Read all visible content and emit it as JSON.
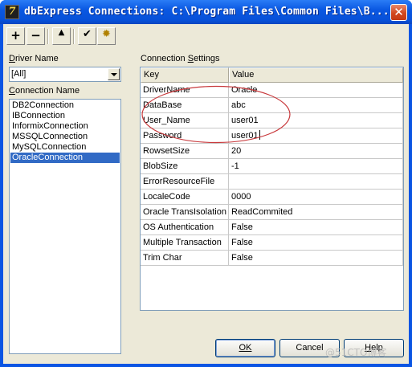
{
  "window": {
    "title": "dbExpress Connections: C:\\Program Files\\Common Files\\B...",
    "close_glyph": "✕",
    "app_icon": "7"
  },
  "toolbar": {
    "add": "+",
    "remove": "−",
    "up": "▲",
    "check": "✔",
    "gear": "✹"
  },
  "driver": {
    "label": "Driver Name",
    "value": "[All]"
  },
  "connections": {
    "label": "Connection Name",
    "items": [
      "DB2Connection",
      "IBConnection",
      "InformixConnection",
      "MSSQLConnection",
      "MySQLConnection",
      "OracleConnection"
    ],
    "selected_index": 5
  },
  "settings": {
    "label": "Connection Settings",
    "headers": {
      "key": "Key",
      "value": "Value"
    },
    "rows": [
      {
        "key": "DriverName",
        "value": "Oracle"
      },
      {
        "key": "DataBase",
        "value": "abc"
      },
      {
        "key": "User_Name",
        "value": "user01"
      },
      {
        "key": "Password",
        "value": "user01"
      },
      {
        "key": "RowsetSize",
        "value": "20"
      },
      {
        "key": "BlobSize",
        "value": "-1"
      },
      {
        "key": "ErrorResourceFile",
        "value": ""
      },
      {
        "key": "LocaleCode",
        "value": "0000"
      },
      {
        "key": "Oracle TransIsolation",
        "value": "ReadCommited"
      },
      {
        "key": "OS Authentication",
        "value": "False"
      },
      {
        "key": "Multiple Transaction",
        "value": "False"
      },
      {
        "key": "Trim Char",
        "value": "False"
      }
    ]
  },
  "buttons": {
    "ok": "OK",
    "cancel": "Cancel",
    "help": "Help"
  },
  "watermark": "@51CTO博客",
  "colors": {
    "title_bar": "#0a58e2",
    "selection": "#316ac5",
    "annotation_ellipse": "#c8393c"
  }
}
